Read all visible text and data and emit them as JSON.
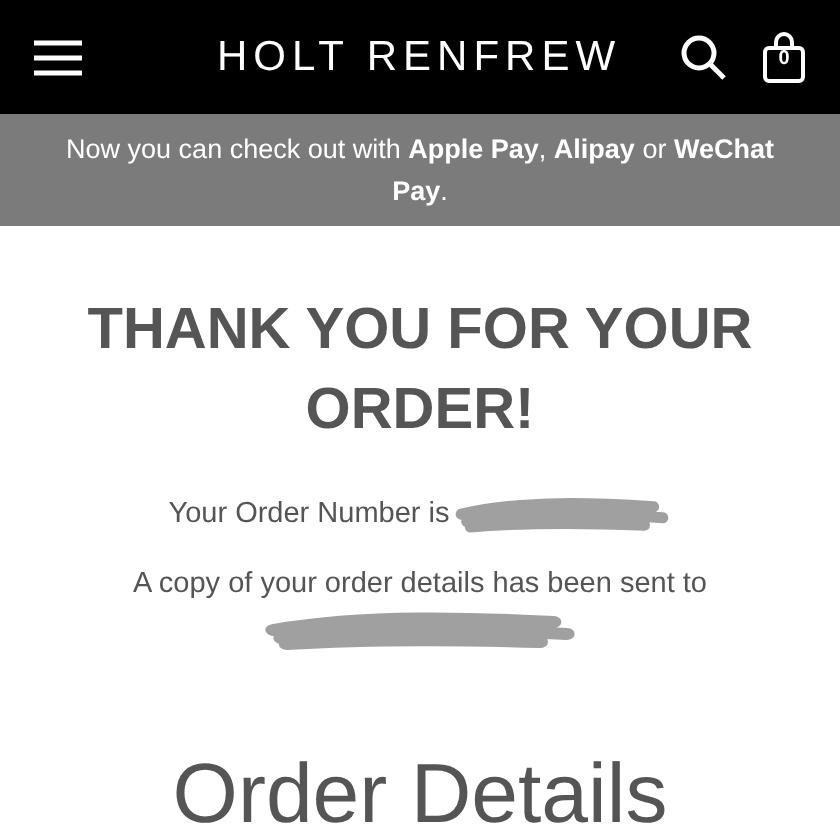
{
  "header": {
    "logo": "HOLT RENFREW",
    "cart_count": "0"
  },
  "banner": {
    "text": "Now you can check out with **Apple Pay**, **Alipay** or **WeChat Pay**."
  },
  "confirmation": {
    "title": "THANK YOU FOR YOUR ORDER!",
    "order_number_label": "Your Order Number is",
    "email_notice": "A copy of your order details has been sent to"
  },
  "section_title": "Order Details"
}
